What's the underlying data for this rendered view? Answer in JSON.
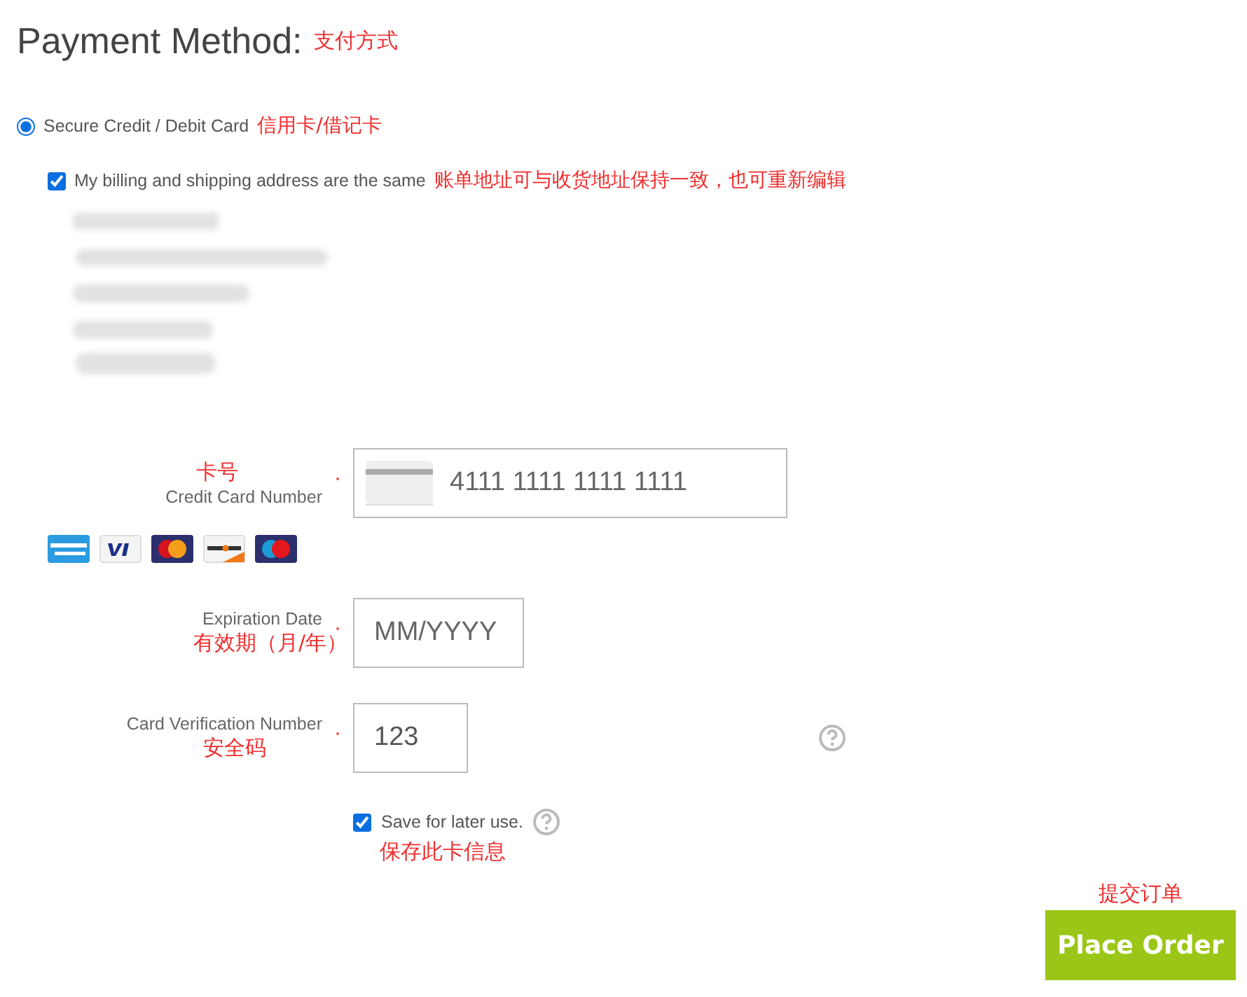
{
  "title": "Payment Method:",
  "title_note": "支付方式",
  "payment_option": {
    "label": "Secure Credit / Debit Card",
    "selected": true,
    "note": "信用卡/借记卡"
  },
  "same_address": {
    "label": "My billing and shipping address are the same",
    "checked": true,
    "note": "账单地址可与收货地址保持一致，也可重新编辑"
  },
  "fields": [
    {
      "kind": "card_number",
      "label": "Credit Card Number",
      "note": "卡号",
      "required": true,
      "placeholder": "4111 1111 1111 1111"
    },
    {
      "kind": "expiry",
      "label": "Expiration Date",
      "note": "有效期（月/年）",
      "required": true,
      "placeholder": "MM/YYYY"
    },
    {
      "kind": "cvv",
      "label": "Card Verification Number",
      "note": "安全码",
      "required": true,
      "placeholder": "123"
    }
  ],
  "save_card": {
    "label": "Save for later use.",
    "checked": true,
    "note": "保存此卡信息"
  },
  "submit": {
    "label": "Place Order",
    "note": "提交订单"
  }
}
